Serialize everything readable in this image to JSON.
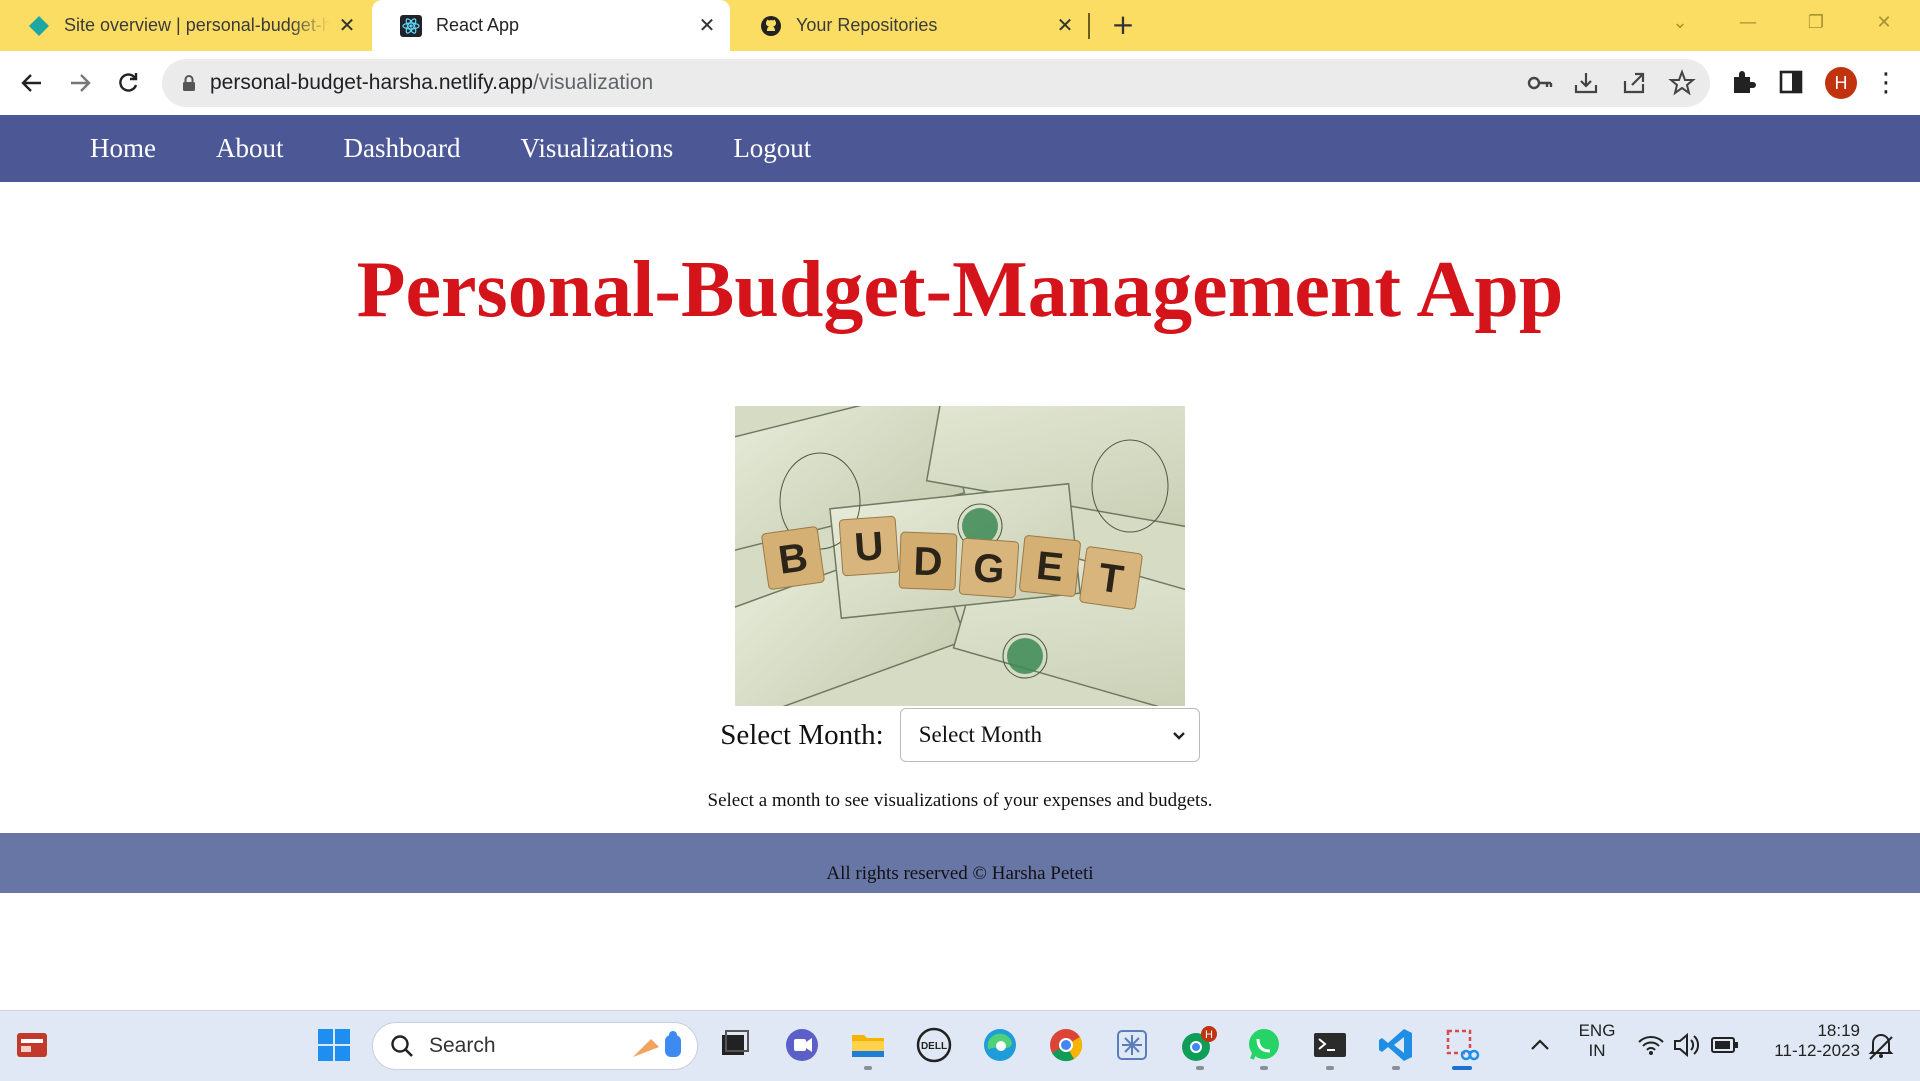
{
  "browser": {
    "tabs": [
      {
        "title": "Site overview | personal-budget-harsha",
        "icon": "netlify-icon",
        "active": false
      },
      {
        "title": "React App",
        "icon": "react-icon",
        "active": true
      },
      {
        "title": "Your Repositories",
        "icon": "github-icon",
        "active": false
      }
    ],
    "close_glyph": "✕",
    "new_tab_glyph": "+",
    "url_host": "personal-budget-harsha.netlify.app",
    "url_path": "/visualization",
    "profile_initial": "H"
  },
  "navbar": {
    "items": [
      "Home",
      "About",
      "Dashboard",
      "Visualizations",
      "Logout"
    ],
    "bg_color": "#4c5896"
  },
  "main": {
    "title": "Personal-Budget-Management App",
    "title_color": "#d5131a",
    "image_word": "BUDGET",
    "select_label": "Select Month:",
    "select_value": "Select Month",
    "hint": "Select a month to see visualizations of your expenses and budgets."
  },
  "footer": {
    "text": "All rights reserved © Harsha Peteti"
  },
  "taskbar": {
    "search_placeholder": "Search",
    "lang_line1": "ENG",
    "lang_line2": "IN",
    "time": "18:19",
    "date": "11-12-2023",
    "chrome_badge": "H"
  }
}
